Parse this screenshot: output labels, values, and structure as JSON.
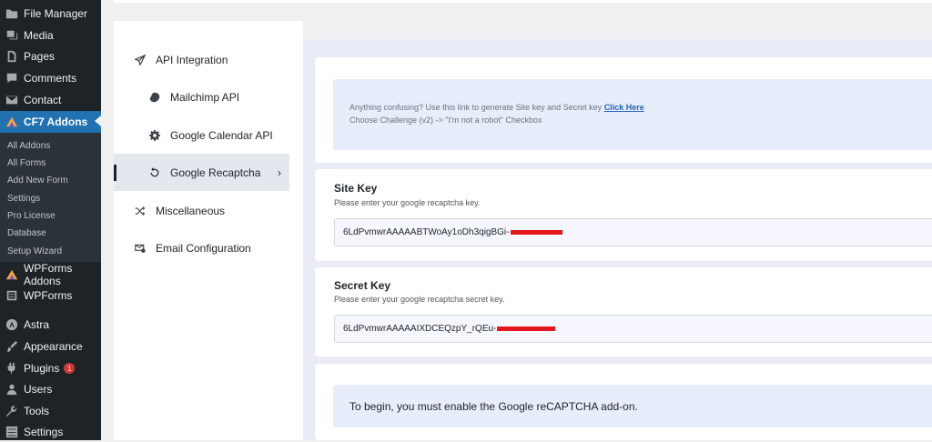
{
  "wp_menu": {
    "items": [
      {
        "label": "File Manager",
        "icon": "folder-icon"
      },
      {
        "label": "Media",
        "icon": "media-icon"
      },
      {
        "label": "Pages",
        "icon": "pages-icon"
      },
      {
        "label": "Comments",
        "icon": "comments-icon"
      },
      {
        "label": "Contact",
        "icon": "mail-icon"
      },
      {
        "label": "CF7 Addons",
        "icon": "cf7-logo-icon"
      },
      {
        "label": "WPForms Addons",
        "icon": "wpforms-addons-logo-icon"
      },
      {
        "label": "WPForms",
        "icon": "wpforms-icon"
      },
      {
        "label": "Astra",
        "icon": "astra-icon"
      },
      {
        "label": "Appearance",
        "icon": "paintbrush-icon"
      },
      {
        "label": "Plugins",
        "icon": "plugin-icon",
        "badge": "1"
      },
      {
        "label": "Users",
        "icon": "users-icon"
      },
      {
        "label": "Tools",
        "icon": "wrench-icon"
      },
      {
        "label": "Settings",
        "icon": "settings-icon"
      }
    ],
    "submenu": [
      "All Addons",
      "All Forms",
      "Add New Form",
      "Settings",
      "Pro License",
      "Database",
      "Setup Wizard"
    ]
  },
  "settings_nav": {
    "api_integration": "API Integration",
    "mailchimp": "Mailchimp API",
    "google_calendar": "Google Calendar API",
    "google_recaptcha": "Google Recaptcha",
    "miscellaneous": "Miscellaneous",
    "email_configuration": "Email Configuration",
    "chevron": "›"
  },
  "info": {
    "line1": "Anything confusing? Use this link to generate Site key and Secret key",
    "link": "Click Here",
    "line2": "Choose Challenge (v2) -> \"I'm not a robot\" Checkbox"
  },
  "site_key": {
    "label": "Site Key",
    "help": "Please enter your google recaptcha key.",
    "value": "6LdPvmwrAAAAABTWoAy1oDh3qigBGi-"
  },
  "secret_key": {
    "label": "Secret Key",
    "help": "Please enter your google recaptcha secret key.",
    "value": "6LdPvmwrAAAAAIXDCEQzpY_rQEu-"
  },
  "notice": "To begin, you must enable the Google reCAPTCHA add-on.",
  "colors": {
    "wp_sidebar": "#1d2327",
    "wp_active": "#2271b1",
    "redaction": "#e3161b",
    "panel_bg": "#e9ebf7"
  }
}
